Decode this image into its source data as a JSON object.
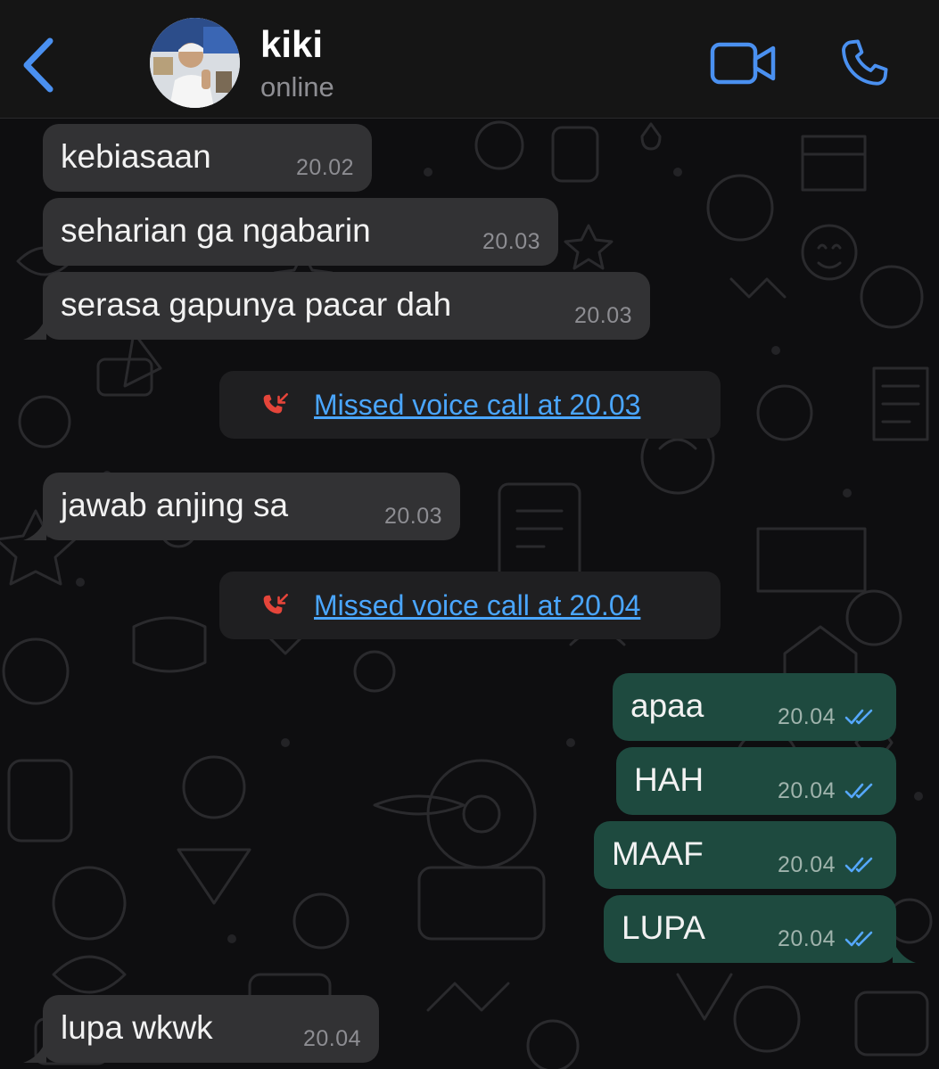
{
  "header": {
    "back_icon": "chevron-left-icon",
    "contact_name": "kiki",
    "contact_status": "online",
    "video_icon": "video-camera-icon",
    "call_icon": "phone-icon",
    "accent_color": "#4a90f0"
  },
  "messages": [
    {
      "direction": "in",
      "text": "kebiasaan",
      "time": "20.02"
    },
    {
      "direction": "in",
      "text": "seharian ga ngabarin",
      "time": "20.03"
    },
    {
      "direction": "in",
      "text": "serasa gapunya pacar dah",
      "time": "20.03"
    },
    {
      "direction": "system",
      "text": "Missed voice call at 20.03",
      "icon": "missed-call-icon"
    },
    {
      "direction": "in",
      "text": "jawab anjing sa",
      "time": "20.03"
    },
    {
      "direction": "system",
      "text": "Missed voice call at 20.04",
      "icon": "missed-call-icon"
    },
    {
      "direction": "out",
      "text": "apaa",
      "time": "20.04",
      "status": "read"
    },
    {
      "direction": "out",
      "text": "HAH",
      "time": "20.04",
      "status": "read"
    },
    {
      "direction": "out",
      "text": "MAAF",
      "time": "20.04",
      "status": "read"
    },
    {
      "direction": "out",
      "text": "LUPA",
      "time": "20.04",
      "status": "read"
    },
    {
      "direction": "in",
      "text": "lupa wkwk",
      "time": "20.04"
    }
  ],
  "colors": {
    "incoming_bubble": "#323234",
    "outgoing_bubble": "#1e4a3f",
    "missed_call_icon": "#e5453a",
    "link": "#4aa6ff",
    "read_ticks": "#55a8ff"
  }
}
